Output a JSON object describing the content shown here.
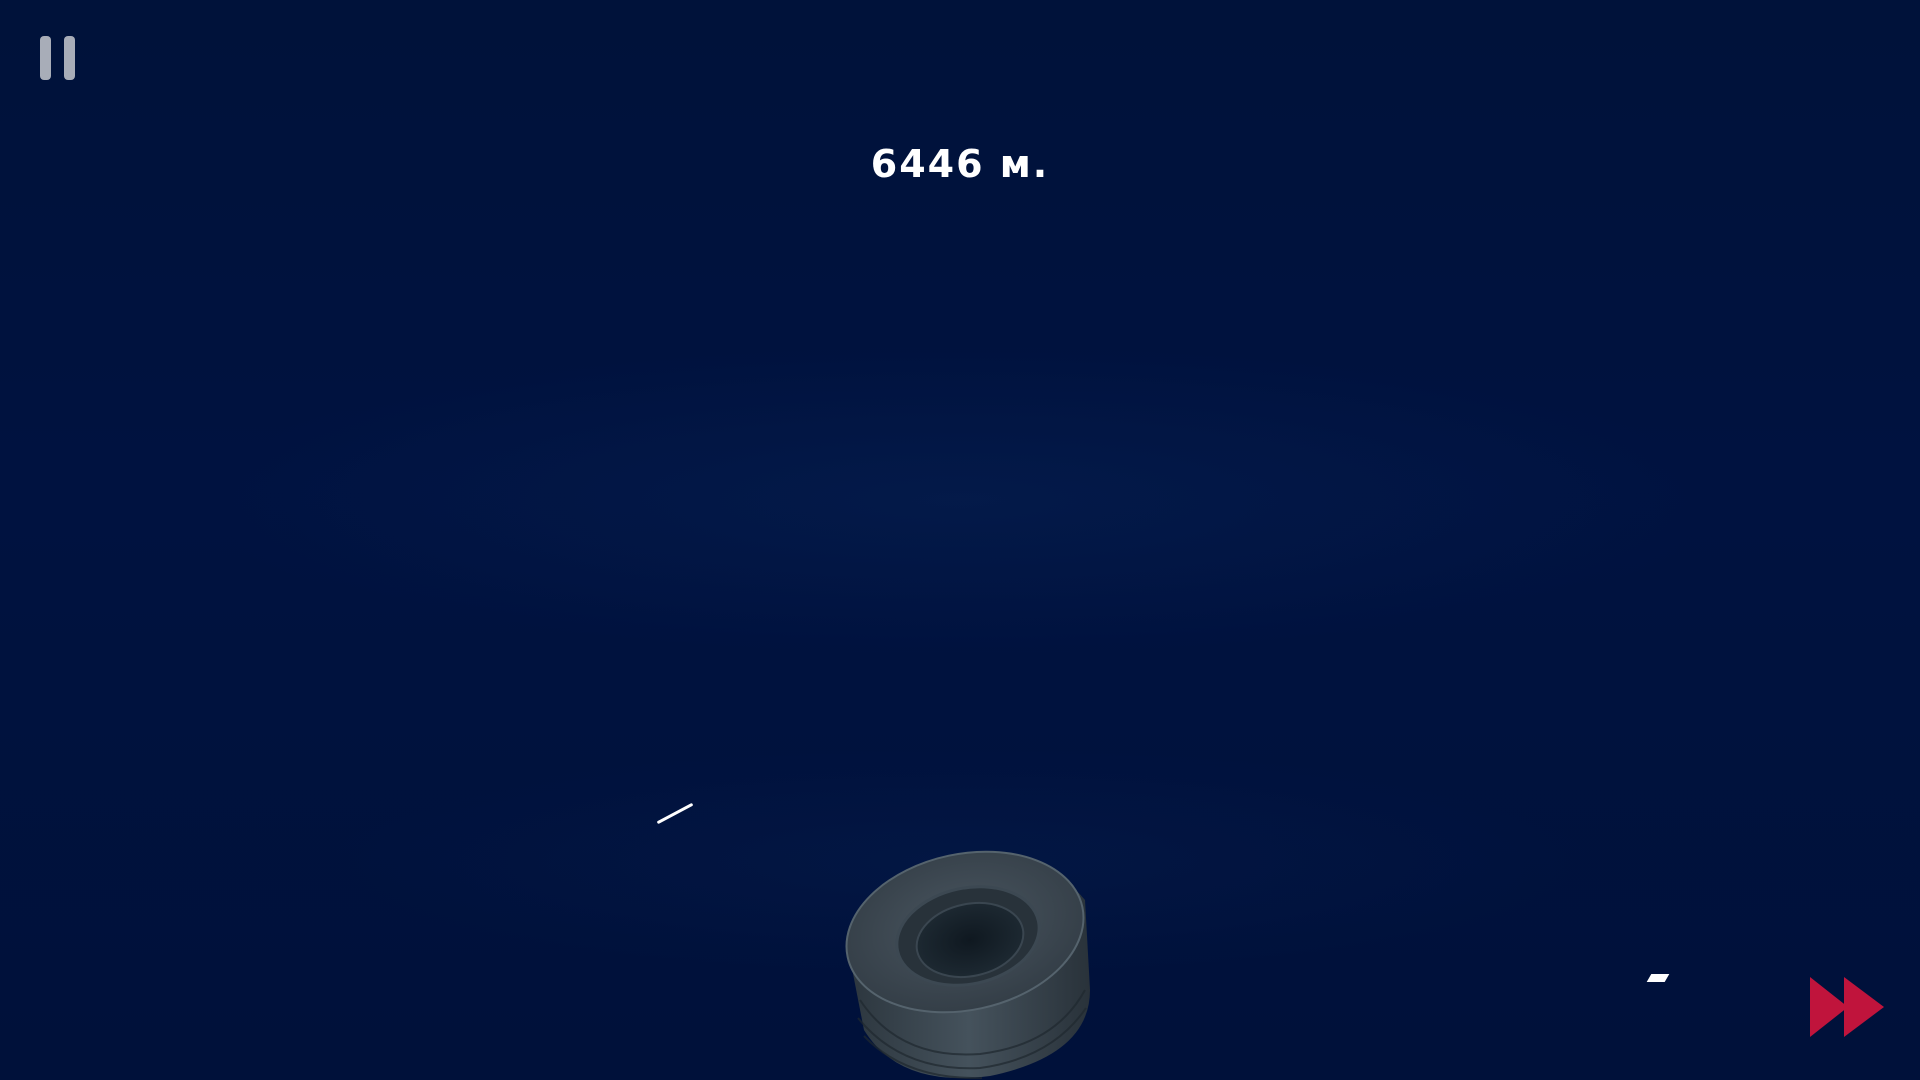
{
  "hud": {
    "distance_label": "6446 м.",
    "pause_icon": "pause-icon",
    "fast_forward_icon": "fast-forward-icon"
  },
  "colors": {
    "background": "#00123a",
    "text": "#ffffff",
    "pause_button": "#a8adb8",
    "fast_forward_button": "#c0143c",
    "tire": "#3a4650"
  }
}
